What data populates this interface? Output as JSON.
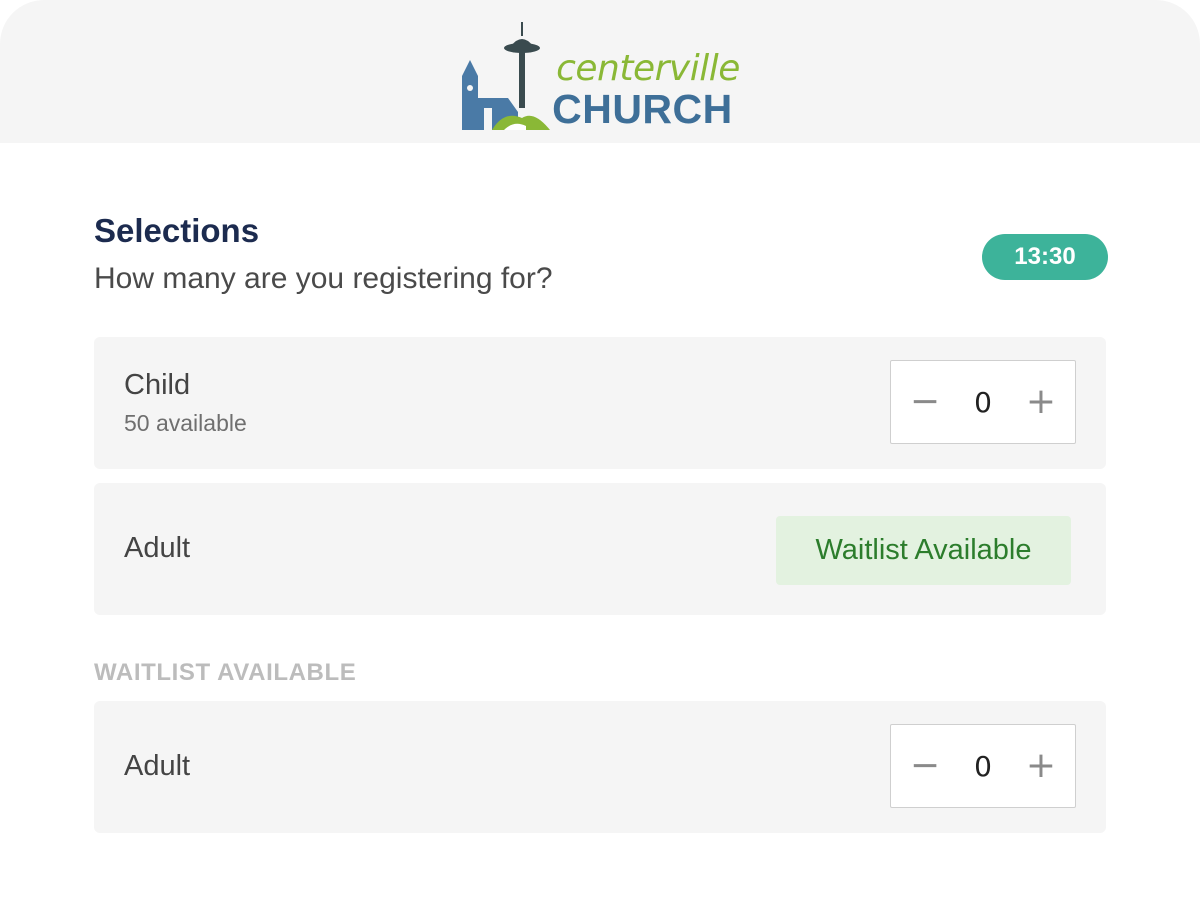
{
  "brand": {
    "name_top": "centerville",
    "name_bottom": "CHURCH",
    "colors": {
      "blue": "#4a7aa6",
      "green": "#8ab836",
      "dark": "#3a4b4f"
    }
  },
  "selections": {
    "title": "Selections",
    "subtitle": "How many are you registering for?",
    "timer": "13:30"
  },
  "items": [
    {
      "label": "Child",
      "availability": "50 available",
      "quantity": "0",
      "decrement_icon": "minus-icon",
      "increment_icon": "plus-icon"
    },
    {
      "label": "Adult",
      "status": "Waitlist Available"
    }
  ],
  "waitlist": {
    "heading": "WAITLIST AVAILABLE",
    "items": [
      {
        "label": "Adult",
        "quantity": "0",
        "decrement_icon": "minus-icon",
        "increment_icon": "plus-icon"
      }
    ]
  },
  "colors": {
    "timer_bg": "#3db39a",
    "title": "#1c2b4f",
    "waitlist_badge_bg": "#e3f2e0",
    "waitlist_badge_text": "#2c7d2c"
  }
}
